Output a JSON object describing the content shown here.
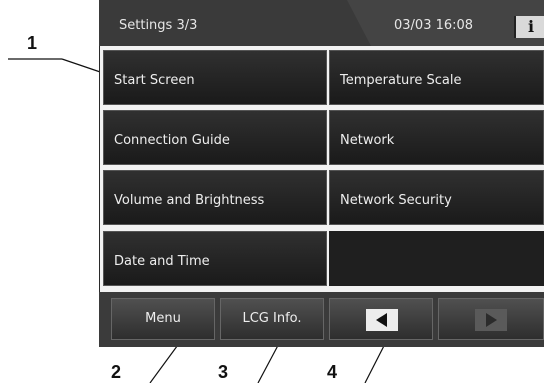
{
  "callouts": {
    "one": "1",
    "two": "2",
    "three": "3",
    "four": "4"
  },
  "header": {
    "title": "Settings 3/3",
    "datetime": "03/03 16:08",
    "info_label": "i"
  },
  "menu_items": {
    "start_screen": "Start Screen",
    "temperature_scale": "Temperature Scale",
    "connection_guide": "Connection Guide",
    "network": "Network",
    "volume_brightness": "Volume and Brightness",
    "network_security": "Network Security",
    "date_time": "Date and Time"
  },
  "toolbar": {
    "menu_label": "Menu",
    "lcg_label": "LCG Info.",
    "prev_icon": "triangle-left-icon",
    "next_icon": "triangle-right-icon"
  },
  "colors": {
    "screen_bg": "#2a2a2a",
    "button_text": "#eeeeee",
    "panel_frame": "#f2f2f2"
  }
}
